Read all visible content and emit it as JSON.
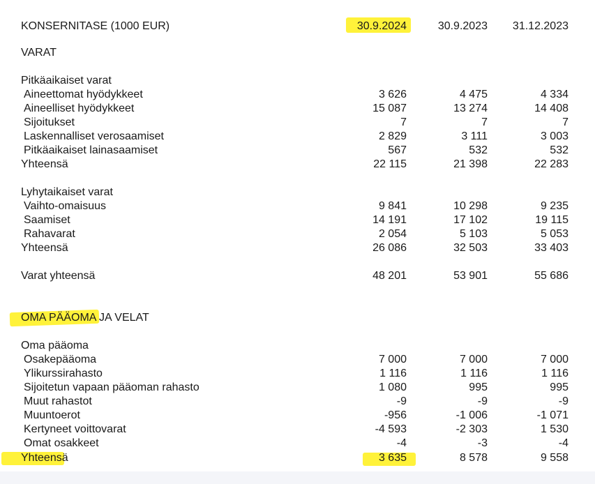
{
  "header": {
    "title": "KONSERNITASE (1000 EUR)",
    "col1": "30.9.2024",
    "col2": "30.9.2023",
    "col3": "31.12.2023"
  },
  "assets": {
    "heading": "VARAT",
    "noncurrent": {
      "heading": "Pitkäaikaiset varat",
      "rows": [
        {
          "label": "Aineettomat hyödykkeet",
          "v": [
            "3 626",
            "4 475",
            "4 334"
          ]
        },
        {
          "label": "Aineelliset hyödykkeet",
          "v": [
            "15 087",
            "13 274",
            "14 408"
          ]
        },
        {
          "label": "Sijoitukset",
          "v": [
            "7",
            "7",
            "7"
          ]
        },
        {
          "label": "Laskennalliset verosaamiset",
          "v": [
            "2 829",
            "3 111",
            "3 003"
          ]
        },
        {
          "label": "Pitkäaikaiset lainasaamiset",
          "v": [
            "567",
            "532",
            "532"
          ]
        }
      ],
      "total": {
        "label": "Yhteensä",
        "v": [
          "22 115",
          "21 398",
          "22 283"
        ]
      }
    },
    "current": {
      "heading": "Lyhytaikaiset varat",
      "rows": [
        {
          "label": "Vaihto-omaisuus",
          "v": [
            "9 841",
            "10 298",
            "9 235"
          ]
        },
        {
          "label": "Saamiset",
          "v": [
            "14 191",
            "17 102",
            "19 115"
          ]
        },
        {
          "label": "Rahavarat",
          "v": [
            "2 054",
            "5 103",
            "5 053"
          ]
        }
      ],
      "total": {
        "label": "Yhteensä",
        "v": [
          "26 086",
          "32 503",
          "33 403"
        ]
      }
    },
    "grand_total": {
      "label": "Varat yhteensä",
      "v": [
        "48 201",
        "53 901",
        "55 686"
      ]
    }
  },
  "equity_liabilities": {
    "heading": "OMA PÄÄOMA JA VELAT",
    "equity": {
      "heading": "Oma pääoma",
      "rows": [
        {
          "label": "Osakepääoma",
          "v": [
            "7 000",
            "7 000",
            "7 000"
          ]
        },
        {
          "label": "Ylikurssirahasto",
          "v": [
            "1 116",
            "1 116",
            "1 116"
          ]
        },
        {
          "label": "Sijoitetun vapaan pääoman rahasto",
          "v": [
            "1 080",
            "995",
            "995"
          ]
        },
        {
          "label": "Muut rahastot",
          "v": [
            "-9",
            "-9",
            "-9"
          ]
        },
        {
          "label": "Muuntoerot",
          "v": [
            "-956",
            "-1 006",
            "-1 071"
          ]
        },
        {
          "label": "Kertyneet voittovarat",
          "v": [
            "-4 593",
            "-2 303",
            "1 530"
          ]
        },
        {
          "label": "Omat osakkeet",
          "v": [
            "-4",
            "-3",
            "-4"
          ]
        }
      ],
      "total": {
        "label": "Yhteensä",
        "v": [
          "3 635",
          "8 578",
          "9 558"
        ]
      }
    }
  },
  "highlight_color": "#fff23a"
}
